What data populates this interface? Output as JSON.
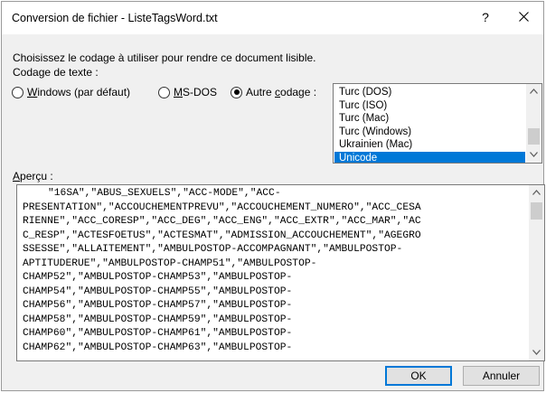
{
  "window": {
    "title": "Conversion de fichier - ListeTagsWord.txt",
    "help_label": "?"
  },
  "prompt": "Choisissez le codage à utiliser pour rendre ce document lisible.",
  "encoding_label": "Codage de texte :",
  "radios": {
    "windows": {
      "pre": "",
      "accel": "W",
      "post": "indows (par défaut)",
      "checked": false
    },
    "msdos": {
      "pre": "",
      "accel": "M",
      "post": "S-DOS",
      "checked": false
    },
    "other": {
      "pre": "Autre ",
      "accel": "c",
      "post": "odage :",
      "checked": true
    }
  },
  "encodings": {
    "items": [
      "Turc (DOS)",
      "Turc (ISO)",
      "Turc (Mac)",
      "Turc (Windows)",
      "Ukrainien (Mac)",
      "Unicode"
    ],
    "selected": "Unicode"
  },
  "preview_label": {
    "accel": "A",
    "post": "perçu :"
  },
  "preview_lines": [
    "\"16SA\",\"ABUS_SEXUELS\",\"ACC-MODE\",\"ACC-",
    "PRESENTATION\",\"ACCOUCHEMENTPREVU\",\"ACCOUCHEMENT_NUMERO\",\"ACC_CESA",
    "RIENNE\",\"ACC_CORESP\",\"ACC_DEG\",\"ACC_ENG\",\"ACC_EXTR\",\"ACC_MAR\",\"AC",
    "C_RESP\",\"ACTESFOETUS\",\"ACTESMAT\",\"ADMISSION_ACCOUCHEMENT\",\"AGEGRO",
    "SSESSE\",\"ALLAITEMENT\",\"AMBULPOSTOP-ACCOMPAGNANT\",\"AMBULPOSTOP-",
    "APTITUDERUE\",\"AMBULPOSTOP-CHAMP51\",\"AMBULPOSTOP-",
    "CHAMP52\",\"AMBULPOSTOP-CHAMP53\",\"AMBULPOSTOP-",
    "CHAMP54\",\"AMBULPOSTOP-CHAMP55\",\"AMBULPOSTOP-",
    "CHAMP56\",\"AMBULPOSTOP-CHAMP57\",\"AMBULPOSTOP-",
    "CHAMP58\",\"AMBULPOSTOP-CHAMP59\",\"AMBULPOSTOP-",
    "CHAMP60\",\"AMBULPOSTOP-CHAMP61\",\"AMBULPOSTOP-",
    "CHAMP62\",\"AMBULPOSTOP-CHAMP63\",\"AMBULPOSTOP-"
  ],
  "buttons": {
    "ok": "OK",
    "cancel": "Annuler"
  },
  "colors": {
    "selection": "#0078d7",
    "dialog_bg": "#f0f0f0"
  },
  "icons": {
    "close": "close-icon",
    "scroll_up": "chevron-up-icon",
    "scroll_down": "chevron-down-icon"
  }
}
